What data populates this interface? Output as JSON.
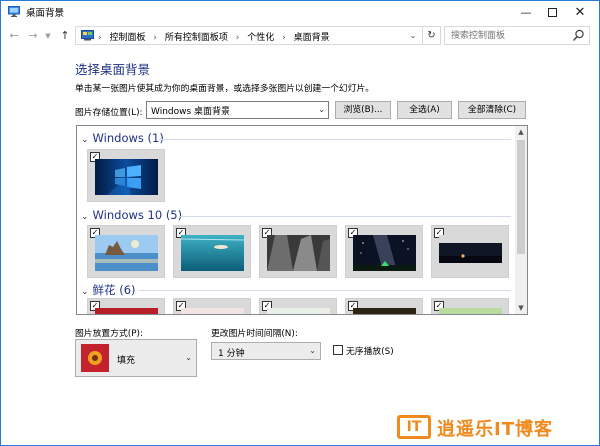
{
  "window": {
    "title": "桌面背景",
    "accent": "#2b7bd6"
  },
  "address": {
    "crumbs": [
      "控制面板",
      "所有控制面板项",
      "个性化",
      "桌面背景"
    ],
    "search_placeholder": "搜索控制面板"
  },
  "content": {
    "heading": "选择桌面背景",
    "subtitle": "单击某一张图片使其成为你的桌面背景，或选择多张图片以创建一个幻灯片。",
    "location_label": "图片存储位置(L):",
    "location_value": "Windows 桌面背景",
    "browse": "浏览(B)...",
    "select_all": "全选(A)",
    "clear_all": "全部清除(C)"
  },
  "gallery": {
    "groups": [
      {
        "label": "Windows (1)",
        "thumbs": [
          "windows-logo-wallpaper"
        ]
      },
      {
        "label": "Windows 10 (5)",
        "thumbs": [
          "beach-rocks",
          "underwater-swimmer",
          "rock-cliff",
          "milky-way-tent",
          "night-horizon"
        ]
      },
      {
        "label": "鲜花 (6)",
        "thumbs": [
          "red-flower",
          "pink-flower",
          "white-flower",
          "red-tulip",
          "green-flower"
        ]
      }
    ]
  },
  "bottom": {
    "position_label": "图片放置方式(P):",
    "position_value": "填充",
    "interval_label": "更改图片时间间隔(N):",
    "interval_value": "1 分钟",
    "shuffle_label": "无序播放(S)"
  },
  "watermark": {
    "text": "逍遥乐IT博客",
    "logo": "IT"
  }
}
